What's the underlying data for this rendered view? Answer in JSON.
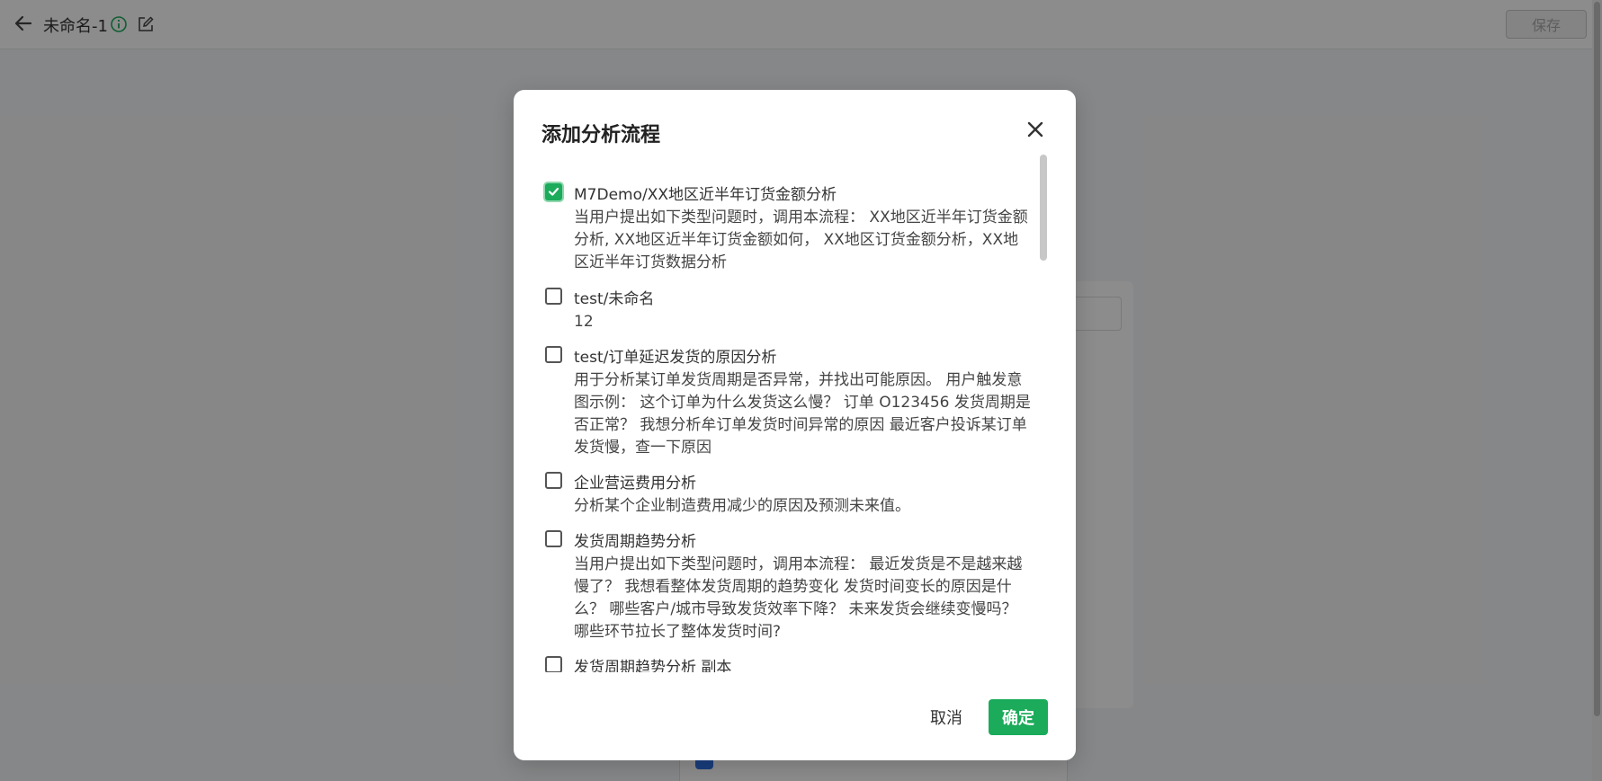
{
  "topbar": {
    "title": "未命名-1",
    "save_label": "保存"
  },
  "modal": {
    "title": "添加分析流程",
    "cancel_label": "取消",
    "ok_label": "确定",
    "items": [
      {
        "checked": true,
        "title": "M7Demo/XX地区近半年订货金额分析",
        "desc": "当用户提出如下类型问题时，调用本流程： XX地区近半年订货金额分析, XX地区近半年订货金额如何， XX地区订货金额分析，XX地区近半年订货数据分析"
      },
      {
        "checked": false,
        "title": "test/未命名",
        "desc": "12"
      },
      {
        "checked": false,
        "title": "test/订单延迟发货的原因分析",
        "desc": "用于分析某订单发货周期是否异常，并找出可能原因。 用户触发意图示例： 这个订单为什么发货这么慢？ 订单 O123456 发货周期是否正常？ 我想分析牟订单发货时间异常的原因 最近客户投诉某订单发货慢，查一下原因"
      },
      {
        "checked": false,
        "title": "企业营运费用分析",
        "desc": "分析某个企业制造费用减少的原因及预测未来值。"
      },
      {
        "checked": false,
        "title": "发货周期趋势分析",
        "desc": "当用户提出如下类型问题时，调用本流程： 最近发货是不是越来越慢了？ 我想看整体发货周期的趋势变化 发货时间变长的原因是什么？ 哪些客户/城市导致发货效率下降？ 未来发货会继续变慢吗？ 哪些环节拉长了整体发货时间?"
      },
      {
        "checked": false,
        "title": "发货周期趋势分析 副本",
        "desc": ""
      }
    ]
  },
  "colors": {
    "accent": "#1bab5a",
    "overlay": "rgba(0,0,0,0.45)"
  },
  "icons": [
    "arrow-left-icon",
    "info-icon",
    "edit-icon",
    "close-icon",
    "check-icon"
  ]
}
